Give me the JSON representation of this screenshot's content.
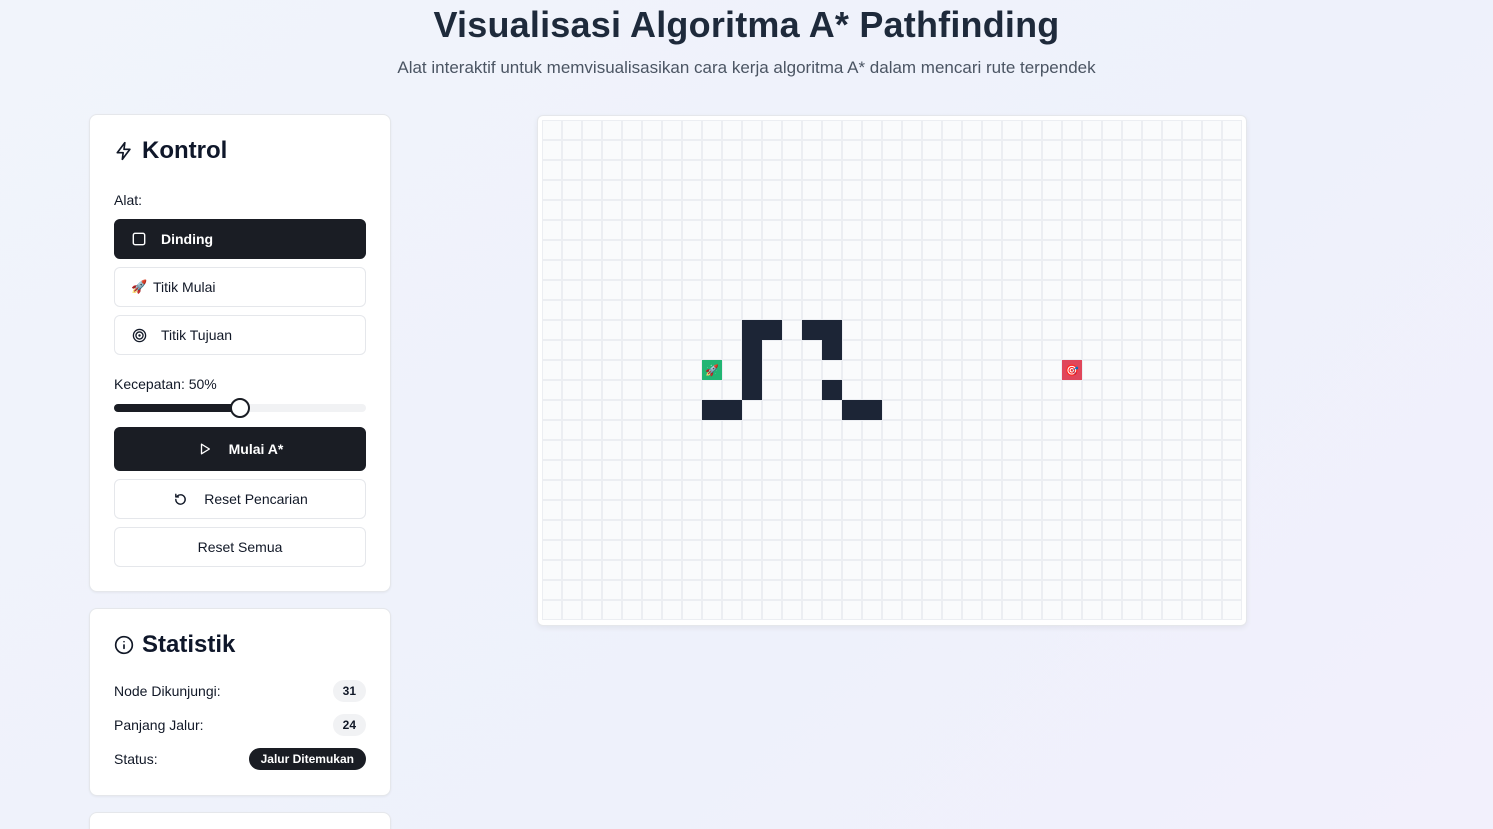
{
  "header": {
    "title": "Visualisasi Algoritma A* Pathfinding",
    "subtitle": "Alat interaktif untuk memvisualisasikan cara kerja algoritma A* dalam mencari rute terpendek"
  },
  "controls": {
    "title": "Kontrol",
    "tools_label": "Alat:",
    "tools": [
      {
        "label": "Dinding",
        "icon": "square-icon",
        "active": true
      },
      {
        "label": "Titik Mulai",
        "icon": "🚀",
        "active": false
      },
      {
        "label": "Titik Tujuan",
        "icon": "target-icon",
        "active": false
      }
    ],
    "speed_label": "Kecepatan: 50%",
    "speed_value": 50,
    "start_button": "Mulai A*",
    "reset_search_button": "Reset Pencarian",
    "reset_all_button": "Reset Semua"
  },
  "stats": {
    "title": "Statistik",
    "visited_label": "Node Dikunjungi:",
    "visited_value": "31",
    "path_label": "Panjang Jalur:",
    "path_value": "24",
    "status_label": "Status:",
    "status_value": "Jalur Ditemukan"
  },
  "grid": {
    "cols": 35,
    "rows": 25,
    "walls": [
      [
        10,
        10
      ],
      [
        10,
        11
      ],
      [
        10,
        13
      ],
      [
        10,
        14
      ],
      [
        11,
        10
      ],
      [
        11,
        14
      ],
      [
        12,
        10
      ],
      [
        13,
        10
      ],
      [
        13,
        14
      ],
      [
        14,
        8
      ],
      [
        14,
        9
      ],
      [
        14,
        15
      ],
      [
        14,
        16
      ]
    ],
    "start": {
      "row": 12,
      "col": 8,
      "icon": "🚀"
    },
    "end": {
      "row": 12,
      "col": 26,
      "icon": "🎯"
    },
    "colors": {
      "wall": "#1c2536",
      "start": "#22b573",
      "end": "#e0465a"
    }
  }
}
